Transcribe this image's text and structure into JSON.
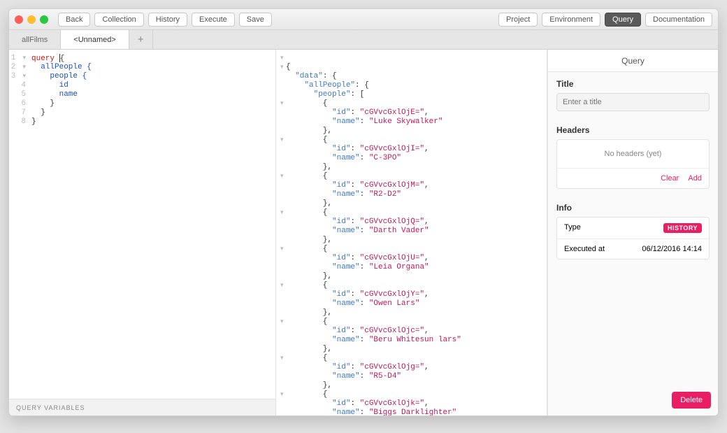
{
  "toolbar": {
    "back": "Back",
    "collection": "Collection",
    "history": "History",
    "execute": "Execute",
    "save": "Save",
    "project": "Project",
    "environment": "Environment",
    "query": "Query",
    "documentation": "Documentation"
  },
  "tabs": {
    "items": [
      {
        "label": "allFilms",
        "active": false
      },
      {
        "label": "<Unnamed>",
        "active": true
      }
    ],
    "plus": "+"
  },
  "editor": {
    "lines": [
      "1",
      "2",
      "3",
      "4",
      "5",
      "6",
      "7",
      "8"
    ],
    "code": {
      "l1_kw": "query",
      "l1_brace": " {",
      "l2": "  allPeople {",
      "l3": "    people {",
      "l4": "      id",
      "l5": "      name",
      "l6": "    }",
      "l7": "  }",
      "l8": "}"
    },
    "vars_label": "QUERY VARIABLES"
  },
  "result": {
    "tokens": [
      [
        "p",
        "{"
      ],
      [
        "k",
        "  \"data\""
      ],
      [
        "p",
        ": {"
      ],
      [
        "k",
        "    \"allPeople\""
      ],
      [
        "p",
        ": {"
      ],
      [
        "k",
        "      \"people\""
      ],
      [
        "p",
        ": ["
      ],
      [
        "p",
        "        {"
      ],
      [
        "k",
        "          \"id\""
      ],
      [
        "p",
        ": "
      ],
      [
        "s",
        "\"cGVvcGxlOjE=\""
      ],
      [
        "p",
        ","
      ],
      [
        "k",
        "          \"name\""
      ],
      [
        "p",
        ": "
      ],
      [
        "s",
        "\"Luke Skywalker\""
      ],
      [
        "p",
        "        },"
      ],
      [
        "p",
        "        {"
      ],
      [
        "k",
        "          \"id\""
      ],
      [
        "p",
        ": "
      ],
      [
        "s",
        "\"cGVvcGxlOjI=\""
      ],
      [
        "p",
        ","
      ],
      [
        "k",
        "          \"name\""
      ],
      [
        "p",
        ": "
      ],
      [
        "s",
        "\"C-3PO\""
      ],
      [
        "p",
        "        },"
      ],
      [
        "p",
        "        {"
      ],
      [
        "k",
        "          \"id\""
      ],
      [
        "p",
        ": "
      ],
      [
        "s",
        "\"cGVvcGxlOjM=\""
      ],
      [
        "p",
        ","
      ],
      [
        "k",
        "          \"name\""
      ],
      [
        "p",
        ": "
      ],
      [
        "s",
        "\"R2-D2\""
      ],
      [
        "p",
        "        },"
      ],
      [
        "p",
        "        {"
      ],
      [
        "k",
        "          \"id\""
      ],
      [
        "p",
        ": "
      ],
      [
        "s",
        "\"cGVvcGxlOjQ=\""
      ],
      [
        "p",
        ","
      ],
      [
        "k",
        "          \"name\""
      ],
      [
        "p",
        ": "
      ],
      [
        "s",
        "\"Darth Vader\""
      ],
      [
        "p",
        "        },"
      ],
      [
        "p",
        "        {"
      ],
      [
        "k",
        "          \"id\""
      ],
      [
        "p",
        ": "
      ],
      [
        "s",
        "\"cGVvcGxlOjU=\""
      ],
      [
        "p",
        ","
      ],
      [
        "k",
        "          \"name\""
      ],
      [
        "p",
        ": "
      ],
      [
        "s",
        "\"Leia Organa\""
      ],
      [
        "p",
        "        },"
      ],
      [
        "p",
        "        {"
      ],
      [
        "k",
        "          \"id\""
      ],
      [
        "p",
        ": "
      ],
      [
        "s",
        "\"cGVvcGxlOjY=\""
      ],
      [
        "p",
        ","
      ],
      [
        "k",
        "          \"name\""
      ],
      [
        "p",
        ": "
      ],
      [
        "s",
        "\"Owen Lars\""
      ],
      [
        "p",
        "        },"
      ],
      [
        "p",
        "        {"
      ],
      [
        "k",
        "          \"id\""
      ],
      [
        "p",
        ": "
      ],
      [
        "s",
        "\"cGVvcGxlOjc=\""
      ],
      [
        "p",
        ","
      ],
      [
        "k",
        "          \"name\""
      ],
      [
        "p",
        ": "
      ],
      [
        "s",
        "\"Beru Whitesun lars\""
      ],
      [
        "p",
        "        },"
      ],
      [
        "p",
        "        {"
      ],
      [
        "k",
        "          \"id\""
      ],
      [
        "p",
        ": "
      ],
      [
        "s",
        "\"cGVvcGxlOjg=\""
      ],
      [
        "p",
        ","
      ],
      [
        "k",
        "          \"name\""
      ],
      [
        "p",
        ": "
      ],
      [
        "s",
        "\"R5-D4\""
      ],
      [
        "p",
        "        },"
      ],
      [
        "p",
        "        {"
      ],
      [
        "k",
        "          \"id\""
      ],
      [
        "p",
        ": "
      ],
      [
        "s",
        "\"cGVvcGxlOjk=\""
      ],
      [
        "p",
        ","
      ],
      [
        "k",
        "          \"name\""
      ],
      [
        "p",
        ": "
      ],
      [
        "s",
        "\"Biggs Darklighter\""
      ]
    ]
  },
  "side": {
    "header": "Query",
    "title_label": "Title",
    "title_placeholder": "Enter a title",
    "headers_label": "Headers",
    "headers_empty": "No headers (yet)",
    "clear": "Clear",
    "add": "Add",
    "info_label": "Info",
    "info_rows": [
      {
        "k": "Type",
        "v": "HISTORY",
        "badge": true
      },
      {
        "k": "Executed at",
        "v": "06/12/2016 14:14",
        "badge": false
      }
    ],
    "delete": "Delete"
  }
}
